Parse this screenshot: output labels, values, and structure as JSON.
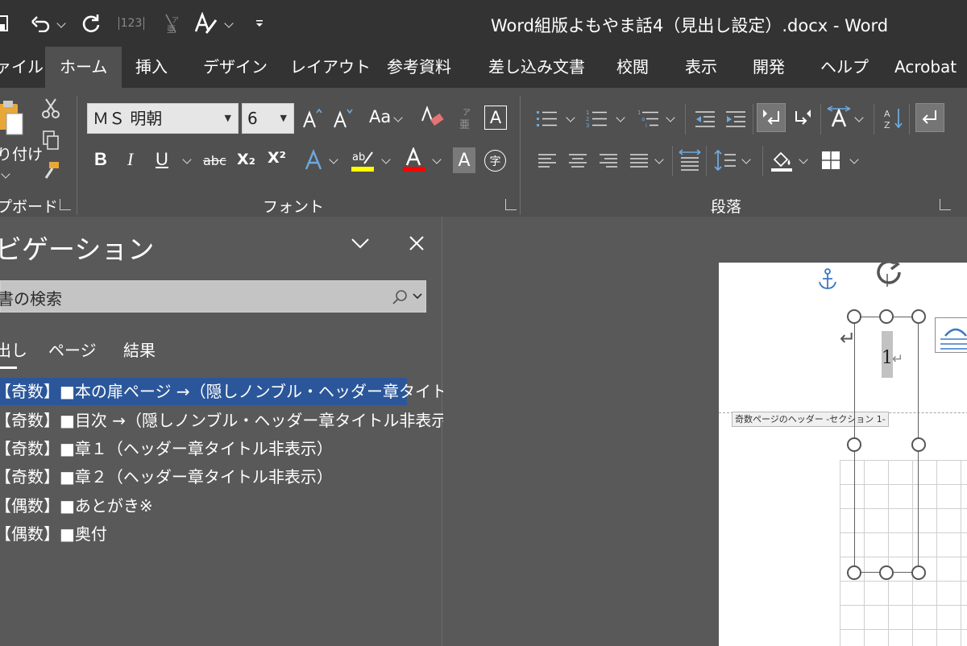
{
  "titlebar": {
    "title": "Word組版よもやま話4（見出し設定）.docx  -  Word",
    "qa_icons": [
      "save-icon",
      "undo-icon",
      "redo-icon",
      "numbering-123-icon",
      "furigana-icon",
      "text-effects-icon",
      "customize-qa-icon"
    ],
    "qa_number_label": "123"
  },
  "tabs": [
    "ァイル",
    "ホーム",
    "挿入",
    "デザイン",
    "レイアウト",
    "参考資料",
    "差し込み文書",
    "校閲",
    "表示",
    "開発",
    "ヘルプ",
    "Acrobat"
  ],
  "ribbon": {
    "clipboard": {
      "paste_label": "り付け",
      "group_label": "プボード"
    },
    "font": {
      "font_name": "ＭＳ 明朝",
      "font_size": "6",
      "group_label": "フォント",
      "case_label": "Aa",
      "bold": "B",
      "italic": "I",
      "underline": "U",
      "strike": "abc",
      "subscript": "X₂",
      "superscript": "X²",
      "ruby_label": "字",
      "highlight_color": "#ffff00",
      "font_color": "#ff0000"
    },
    "paragraph": {
      "group_label": "段落"
    }
  },
  "nav": {
    "title": "ビゲーション",
    "search_placeholder": "書の検索",
    "tabs": [
      "出し",
      "ページ",
      "結果"
    ],
    "headings": [
      "【奇数】■本の扉ページ →（隠しノンブル・ヘッダー章タイトル…",
      "【奇数】■目次 →（隠しノンブル・ヘッダー章タイトル非表示）",
      "【奇数】■章１（ヘッダー章タイトル非表示）",
      "【奇数】■章２（ヘッダー章タイトル非表示）",
      "【偶数】■あとがき※",
      "【偶数】■奥付"
    ]
  },
  "document": {
    "header_tag": "奇数ページのヘッダー -セクション 1-",
    "page_number": "1"
  },
  "colors": {
    "titlebar_bg": "#333333",
    "ribbon_bg": "#505050",
    "selection": "#2b579a"
  }
}
